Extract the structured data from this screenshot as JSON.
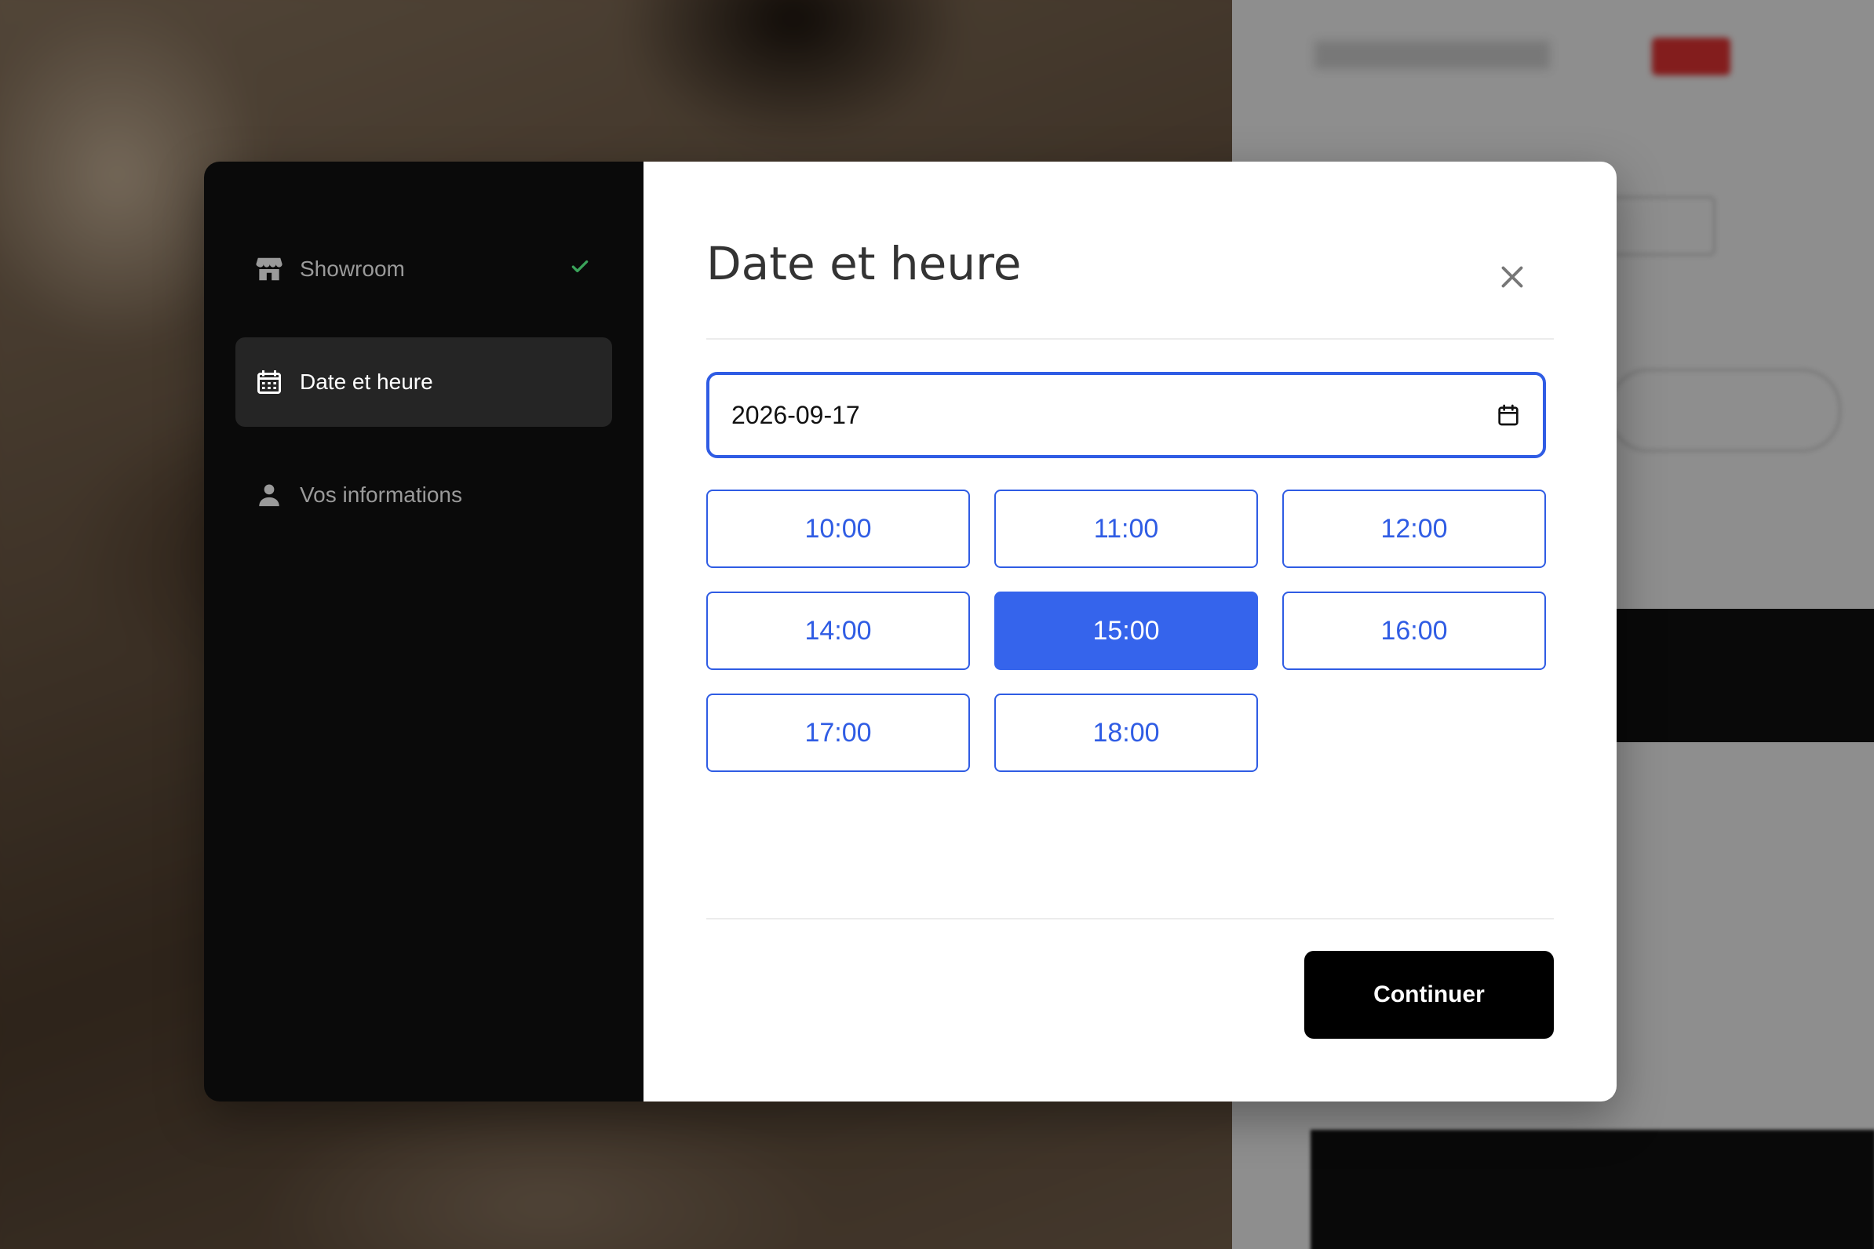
{
  "sidebar": {
    "steps": [
      {
        "label": "Showroom",
        "icon": "store-icon",
        "completed": true,
        "active": false
      },
      {
        "label": "Date et heure",
        "icon": "calendar-icon",
        "completed": false,
        "active": true
      },
      {
        "label": "Vos informations",
        "icon": "user-icon",
        "completed": false,
        "active": false
      }
    ]
  },
  "main": {
    "title": "Date et heure",
    "date_value": "2026-09-17",
    "slots": [
      "10:00",
      "11:00",
      "12:00",
      "14:00",
      "15:00",
      "16:00",
      "17:00",
      "18:00"
    ],
    "selected_slot": "15:00",
    "continue_label": "Continuer"
  },
  "colors": {
    "accent": "#3564ec",
    "sidebar_bg": "#0a0a0a",
    "check": "#3aa35a"
  }
}
